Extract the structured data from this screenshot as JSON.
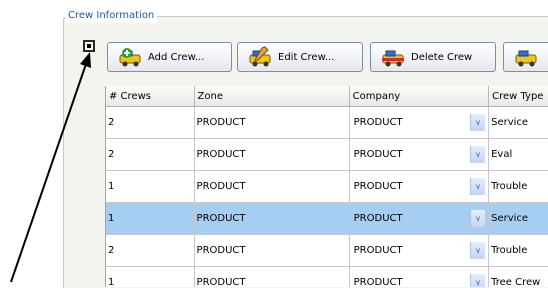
{
  "group": {
    "legend": "Crew Information"
  },
  "toolbar": {
    "buttons": [
      {
        "label": "Add Crew...",
        "icon": "add-crew-icon"
      },
      {
        "label": "Edit Crew...",
        "icon": "edit-crew-icon"
      },
      {
        "label": "Delete Crew",
        "icon": "delete-crew-icon"
      },
      {
        "label": "",
        "icon": "crew-icon"
      }
    ]
  },
  "grid": {
    "columns": [
      "# Crews",
      "Zone",
      "Company",
      "Crew Type"
    ],
    "rows": [
      {
        "crews": "2",
        "zone": "PRODUCT",
        "company": "PRODUCT",
        "crew_type": "Service"
      },
      {
        "crews": "2",
        "zone": "PRODUCT",
        "company": "PRODUCT",
        "crew_type": "Eval"
      },
      {
        "crews": "1",
        "zone": "PRODUCT",
        "company": "PRODUCT",
        "crew_type": "Trouble"
      },
      {
        "crews": "1",
        "zone": "PRODUCT",
        "company": "PRODUCT",
        "crew_type": "Service",
        "selected": true
      },
      {
        "crews": "2",
        "zone": "PRODUCT",
        "company": "PRODUCT",
        "crew_type": "Trouble"
      },
      {
        "crews": "1",
        "zone": "PRODUCT",
        "company": "PRODUCT",
        "crew_type": "Tree Crew"
      }
    ]
  },
  "colors": {
    "legend": "#1a5ba7",
    "selection": "#a6cef3",
    "group_bg": "#f4f4ef"
  }
}
